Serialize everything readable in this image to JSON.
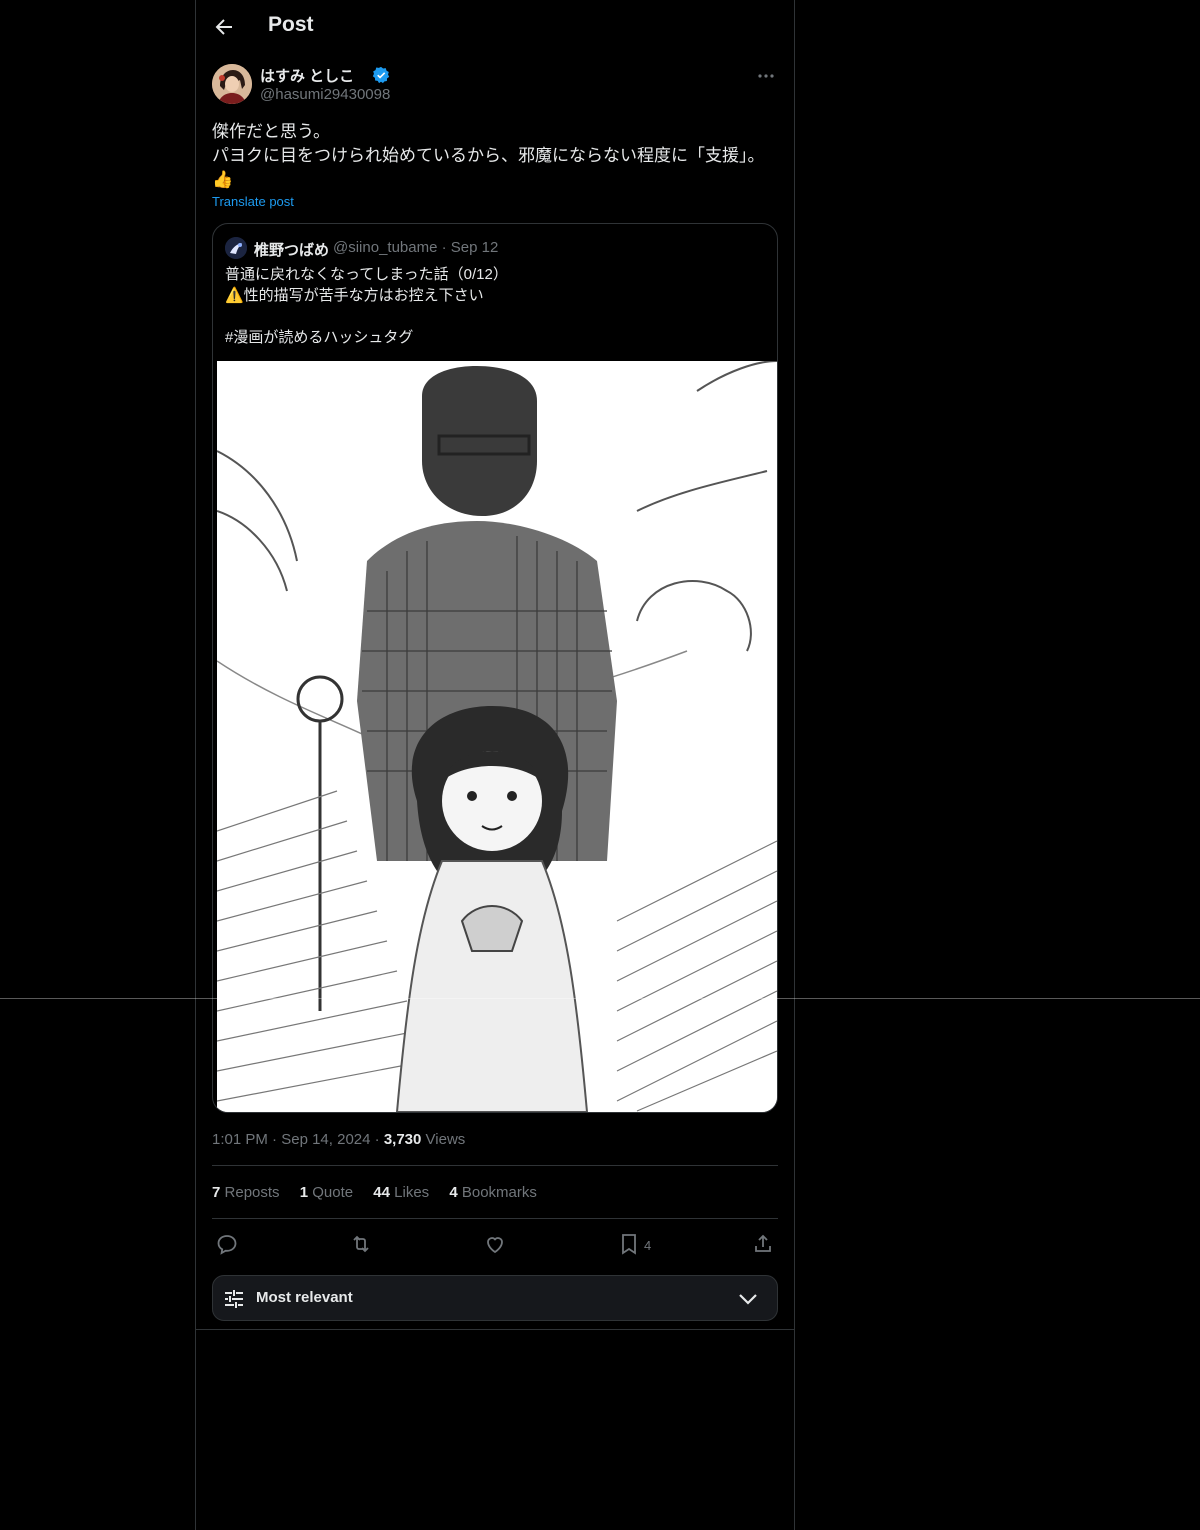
{
  "header": {
    "title": "Post"
  },
  "author": {
    "name": "はすみ としこ",
    "handle": "@hasumi29430098",
    "verified": true
  },
  "post": {
    "lines": [
      "傑作だと思う。",
      "パヨクに目をつけられ始めているから、邪魔にならない程度に「支援」。",
      "👍"
    ],
    "translate_label": "Translate post"
  },
  "quote": {
    "name": "椎野つばめ",
    "handle": "@siino_tubame",
    "separator": "·",
    "date": "Sep 12",
    "lines": [
      "普通に戻れなくなってしまった話（0/12）",
      "⚠️性的描写が苦手な方はお控え下さい",
      "",
      "#漫画が読めるハッシュタグ"
    ]
  },
  "meta": {
    "time": "1:01 PM",
    "separator": "·",
    "date": "Sep 14, 2024",
    "views_count": "3,730",
    "views_label": "Views"
  },
  "stats": {
    "reposts_count": "7",
    "reposts_label": "Reposts",
    "quotes_count": "1",
    "quotes_label": "Quote",
    "likes_count": "44",
    "likes_label": "Likes",
    "bookmarks_count": "4",
    "bookmarks_label": "Bookmarks"
  },
  "actions": {
    "icons": [
      "reply-icon",
      "repost-icon",
      "like-icon",
      "bookmark-icon",
      "share-icon"
    ],
    "bookmark_count": "4"
  },
  "sort": {
    "label": "Most relevant"
  },
  "colors": {
    "background": "#000000",
    "text": "#e7e9ea",
    "muted": "#71767b",
    "accent": "#1d9bf0",
    "border": "#2f3336"
  }
}
